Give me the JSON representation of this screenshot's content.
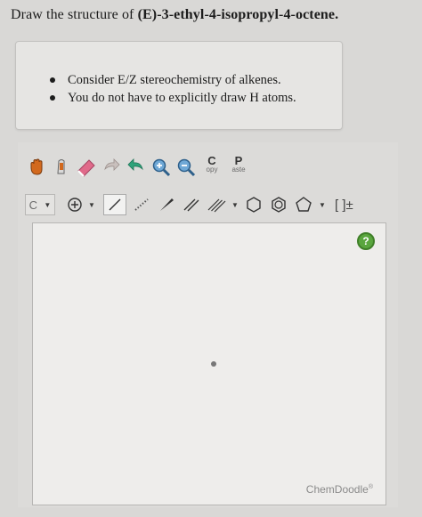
{
  "question": {
    "prefix": "Draw the structure of ",
    "compound": "(E)-3-ethyl-4-isopropyl-4-octene",
    "suffix": "."
  },
  "hints": [
    "Consider E/Z stereochemistry of alkenes.",
    "You do not have to explicitly draw H atoms."
  ],
  "toolbar": {
    "copy": {
      "big": "C",
      "small": "opy"
    },
    "paste": {
      "big": "P",
      "small": "aste"
    },
    "element": "C",
    "brackets": "[ ]±"
  },
  "canvas": {
    "help": "?",
    "brand": "ChemDoodle"
  },
  "colors": {
    "help_green": "#5aa63e",
    "hand_orange": "#d2691e",
    "eraser_pink": "#e06a8a",
    "rotate_green": "#2fa37a",
    "zoom_blue": "#2d5f8a"
  }
}
